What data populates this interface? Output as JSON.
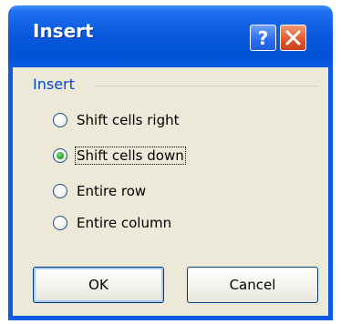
{
  "dialog": {
    "title": "Insert",
    "group_label": "Insert",
    "options": [
      {
        "label": "Shift cells right",
        "selected": false
      },
      {
        "label": "Shift cells down",
        "selected": true
      },
      {
        "label": "Entire row",
        "selected": false
      },
      {
        "label": "Entire column",
        "selected": false
      }
    ],
    "ok_label": "OK",
    "cancel_label": "Cancel"
  },
  "icons": {
    "help": "help-icon",
    "close": "close-icon"
  },
  "colors": {
    "titlebar": "#0a5be1",
    "group_label": "#0046d5",
    "dialog_bg": "#ece9d8",
    "close_button": "#e15a2c"
  }
}
